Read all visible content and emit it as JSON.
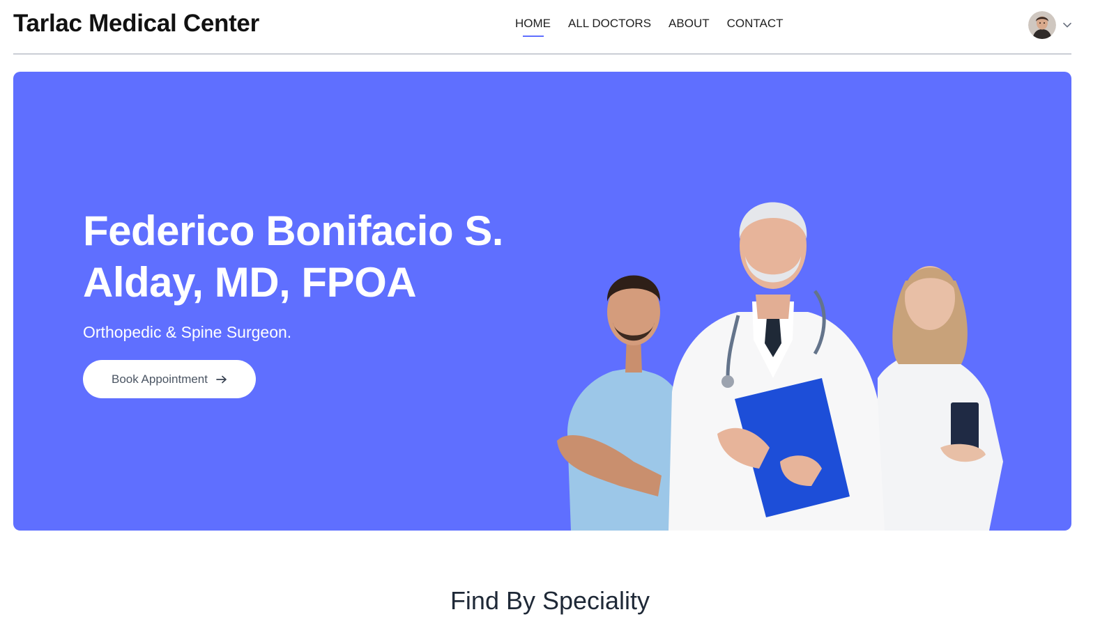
{
  "header": {
    "brand": "Tarlac Medical Center",
    "nav": [
      {
        "label": "HOME",
        "active": true
      },
      {
        "label": "ALL DOCTORS",
        "active": false
      },
      {
        "label": "ABOUT",
        "active": false
      },
      {
        "label": "CONTACT",
        "active": false
      }
    ],
    "profile_icon": "user-avatar",
    "dropdown_icon": "chevron-down-icon"
  },
  "hero": {
    "title": "Federico Bonifacio S. Alday, MD, FPOA",
    "subtitle": "Orthopedic & Spine Surgeon.",
    "cta_label": "Book Appointment",
    "cta_icon": "arrow-right-icon",
    "background_color": "#5f6fff"
  },
  "section": {
    "title": "Find By Speciality"
  },
  "colors": {
    "primary": "#5f6fff",
    "text_dark": "#111111",
    "heading": "#1f2937",
    "button_text": "#4b5563"
  }
}
